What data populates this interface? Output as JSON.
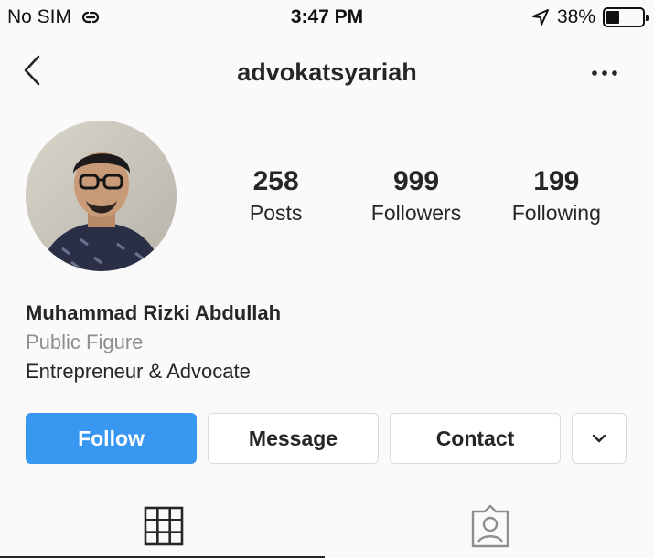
{
  "status_bar": {
    "carrier": "No SIM",
    "time": "3:47 PM",
    "battery_text": "38%",
    "battery_level": 0.38
  },
  "nav": {
    "title": "advokatsyariah"
  },
  "profile": {
    "stats": [
      {
        "value": "258",
        "label": "Posts"
      },
      {
        "value": "999",
        "label": "Followers"
      },
      {
        "value": "199",
        "label": "Following"
      }
    ],
    "name": "Muhammad Rizki Abdullah",
    "category": "Public Figure",
    "bio": "Entrepreneur & Advocate"
  },
  "actions": {
    "follow": "Follow",
    "message": "Message",
    "contact": "Contact"
  },
  "colors": {
    "accent": "#3897f0",
    "text": "#262626",
    "muted": "#8e8e8e",
    "border": "#dbdbdb",
    "background": "#fafafa"
  },
  "icons": [
    "link-icon",
    "location-arrow-icon",
    "battery-icon",
    "back-chevron-icon",
    "more-dots-icon",
    "chevron-down-icon",
    "grid-icon",
    "tagged-icon"
  ]
}
